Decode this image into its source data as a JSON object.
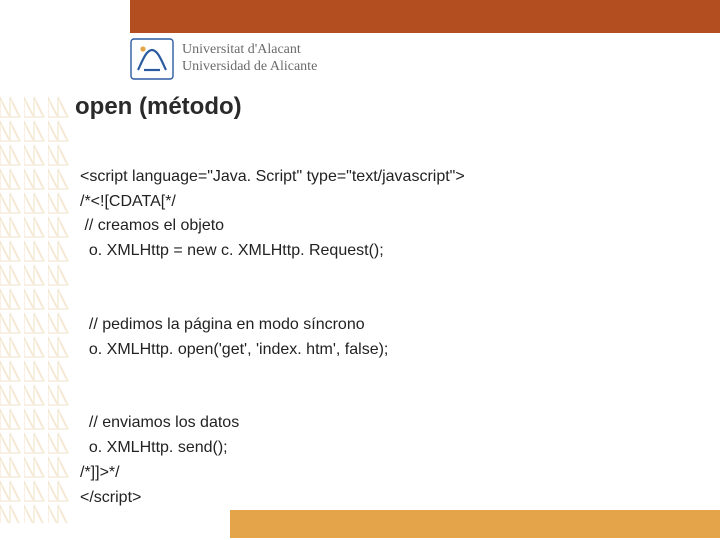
{
  "university": {
    "name_ca": "Universitat d'Alacant",
    "name_es": "Universidad de Alicante"
  },
  "slide": {
    "title": "open (método)"
  },
  "code": {
    "l1": "<script language=\"Java. Script\" type=\"text/javascript\">",
    "l2": "/*<![CDATA[*/",
    "l3": " // creamos el objeto",
    "l4": "  o. XMLHttp = new c. XMLHttp. Request();",
    "l5": "  // pedimos la página en modo síncrono",
    "l6": "  o. XMLHttp. open('get', 'index. htm', false);",
    "l7": "  // enviamos los datos",
    "l8": "  o. XMLHttp. send();",
    "l9": "/*]]>*/",
    "l10": "</script>"
  },
  "colors": {
    "top_bar": "#b24e1f",
    "bottom_bar": "#e4a54a",
    "pattern": "#d4a44a"
  }
}
